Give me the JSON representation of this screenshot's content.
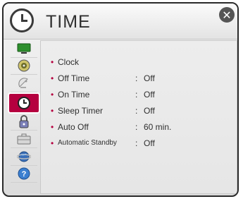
{
  "header": {
    "title": "TIME",
    "icon": "clock-icon",
    "close_icon": "close-icon"
  },
  "sidebar": {
    "items": [
      {
        "name": "picture",
        "icon": "monitor-icon",
        "active": false
      },
      {
        "name": "audio",
        "icon": "speaker-icon",
        "active": false
      },
      {
        "name": "channels",
        "icon": "satellite-dish-icon",
        "active": false
      },
      {
        "name": "time",
        "icon": "clock-icon",
        "active": true
      },
      {
        "name": "lock",
        "icon": "lock-icon",
        "active": false
      },
      {
        "name": "option",
        "icon": "briefcase-icon",
        "active": false
      },
      {
        "name": "network",
        "icon": "globe-icon",
        "active": false
      },
      {
        "name": "support",
        "icon": "help-icon",
        "active": false
      }
    ]
  },
  "rows": [
    {
      "label": "Clock",
      "value": ""
    },
    {
      "label": "Off Time",
      "value": "Off"
    },
    {
      "label": "On Time",
      "value": "Off"
    },
    {
      "label": "Sleep Timer",
      "value": "Off"
    },
    {
      "label": "Auto Off",
      "value": "60 min."
    },
    {
      "label": "Automatic Standby",
      "value": "Off"
    }
  ],
  "colors": {
    "accent": "#b5003f",
    "text": "#2f2f2f"
  }
}
